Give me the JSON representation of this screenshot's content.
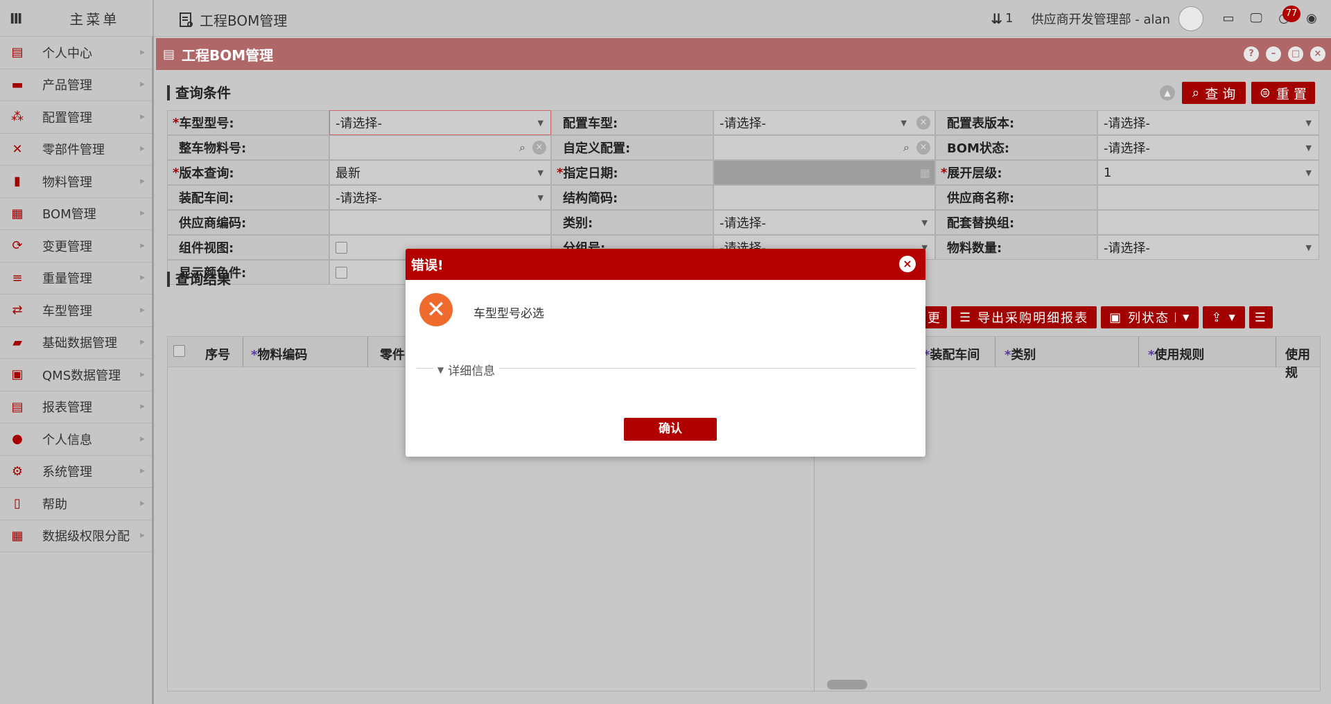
{
  "app": {
    "menu_title": "主菜单",
    "page_title": "工程BOM管理",
    "download_count": "1",
    "user_label": "供应商开发管理部 - alan",
    "notification_count": "77"
  },
  "sidebar": {
    "items": [
      {
        "label": "个人中心",
        "icon": "id-card-icon"
      },
      {
        "label": "产品管理",
        "icon": "toolbox-icon"
      },
      {
        "label": "配置管理",
        "icon": "hierarchy-icon"
      },
      {
        "label": "零部件管理",
        "icon": "tools-icon"
      },
      {
        "label": "物料管理",
        "icon": "book-icon"
      },
      {
        "label": "BOM管理",
        "icon": "bom-icon"
      },
      {
        "label": "变更管理",
        "icon": "refresh-icon"
      },
      {
        "label": "重量管理",
        "icon": "stack-icon"
      },
      {
        "label": "车型管理",
        "icon": "swap-icon"
      },
      {
        "label": "基础数据管理",
        "icon": "note-icon"
      },
      {
        "label": "QMS数据管理",
        "icon": "screen-icon"
      },
      {
        "label": "报表管理",
        "icon": "report-icon"
      },
      {
        "label": "个人信息",
        "icon": "user-icon"
      },
      {
        "label": "系统管理",
        "icon": "gear-icon"
      },
      {
        "label": "帮助",
        "icon": "help-doc-icon"
      },
      {
        "label": "数据级权限分配",
        "icon": "calendar-icon"
      }
    ]
  },
  "window": {
    "title": "工程BOM管理",
    "query_section": "查询条件",
    "query_button": "查 询",
    "reset_button": "重 置",
    "results_section": "查询结果"
  },
  "form": {
    "rows": [
      [
        {
          "label": "车型型号:",
          "req": true,
          "value": "-请选择-",
          "type": "select"
        },
        {
          "label": "配置车型:",
          "req": false,
          "value": "-请选择-",
          "type": "select-clear"
        },
        {
          "label": "配置表版本:",
          "req": false,
          "value": "-请选择-",
          "type": "select"
        }
      ],
      [
        {
          "label": "整车物料号:",
          "req": false,
          "value": "",
          "type": "search-clear"
        },
        {
          "label": "自定义配置:",
          "req": false,
          "value": "",
          "type": "search-clear"
        },
        {
          "label": "BOM状态:",
          "req": false,
          "value": "-请选择-",
          "type": "select"
        }
      ],
      [
        {
          "label": "版本查询:",
          "req": true,
          "value": "最新",
          "type": "select"
        },
        {
          "label": "指定日期:",
          "req": true,
          "value": "",
          "type": "date"
        },
        {
          "label": "展开层级:",
          "req": true,
          "value": "1",
          "type": "select"
        }
      ],
      [
        {
          "label": "装配车间:",
          "req": false,
          "value": "-请选择-",
          "type": "select"
        },
        {
          "label": "结构简码:",
          "req": false,
          "value": "",
          "type": "text"
        },
        {
          "label": "供应商名称:",
          "req": false,
          "value": "",
          "type": "text"
        }
      ],
      [
        {
          "label": "供应商编码:",
          "req": false,
          "value": "",
          "type": "text"
        },
        {
          "label": "类别:",
          "req": false,
          "value": "-请选择-",
          "type": "select"
        },
        {
          "label": "配套替换组:",
          "req": false,
          "value": "",
          "type": "text"
        }
      ],
      [
        {
          "label": "组件视图:",
          "req": false,
          "value": "",
          "type": "checkbox"
        },
        {
          "label": "分组号:",
          "req": false,
          "value": "-请选择-",
          "type": "select"
        },
        {
          "label": "物料数量:",
          "req": false,
          "value": "-请选择-",
          "type": "select"
        }
      ],
      [
        {
          "label": "显示颜色件:",
          "req": false,
          "value": "",
          "type": "checkbox"
        }
      ]
    ]
  },
  "results": {
    "toolbar": {
      "change_label": "更",
      "export_label": "导出采购明细报表",
      "column_state_label": "列状态"
    },
    "columns": [
      "序号",
      "物料编码",
      "零件",
      "装配车间",
      "类别",
      "使用规则",
      "使用规"
    ]
  },
  "dialog": {
    "title": "错误!",
    "message": "车型型号必选",
    "details_label": "详细信息",
    "confirm_label": "确认"
  }
}
